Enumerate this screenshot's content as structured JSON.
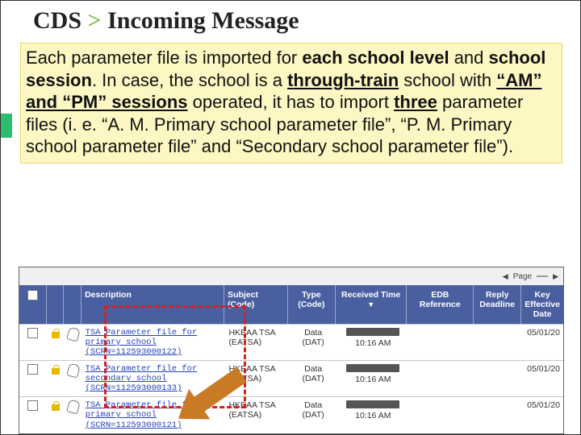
{
  "title": {
    "a": "CDS",
    "sep": ">",
    "b": "Incoming Message"
  },
  "callout": {
    "t1": "Each parameter file is imported for ",
    "b_each_school_level": "each school level",
    "t2": " and ",
    "b_school_session": "school session",
    "t3": ". In case, the school is a ",
    "bu_through_train": "through-train",
    "t4": " school with ",
    "bu_am_pm": "“AM” and “PM” sessions",
    "t5": " operated, it has to import ",
    "bu_three": "three",
    "t6": " parameter files (i. e. “A. M. Primary school parameter file”, “P. M. Primary school parameter file” and “Secondary school parameter file”)."
  },
  "toolbar": {
    "page_prefix": "Page",
    "page_box": ""
  },
  "headers": {
    "desc": "Description",
    "subj": "Subject (Code)",
    "type": "Type (Code)",
    "recv": "Received Time",
    "edb": "EDB Reference",
    "reply": "Reply Deadline",
    "eff": "Key Effective Date"
  },
  "rows": [
    {
      "desc1": "TSA Parameter file for",
      "desc2": "primary school",
      "desc3": "(SCRN=112593000122)",
      "subj1": "HKEAA TSA",
      "subj2": "(EATSA)",
      "type1": "Data",
      "type2": "(DAT)",
      "recv_time": "10:16 AM",
      "eff": "05/01/20"
    },
    {
      "desc1": "TSA Parameter file for",
      "desc2": "secondary school",
      "desc3": "(SCRN=112593000133)",
      "subj1": "HKEAA TSA",
      "subj2": "(EATSA)",
      "type1": "Data",
      "type2": "(DAT)",
      "recv_time": "10:16 AM",
      "eff": "05/01/20"
    },
    {
      "desc1": "TSA Parameter file for",
      "desc2": "primary school",
      "desc3": "(SCRN=112593000121)",
      "subj1": "HKEAA TSA",
      "subj2": "(EATSA)",
      "type1": "Data",
      "type2": "(DAT)",
      "recv_time": "10:16 AM",
      "eff": "05/01/20"
    }
  ]
}
